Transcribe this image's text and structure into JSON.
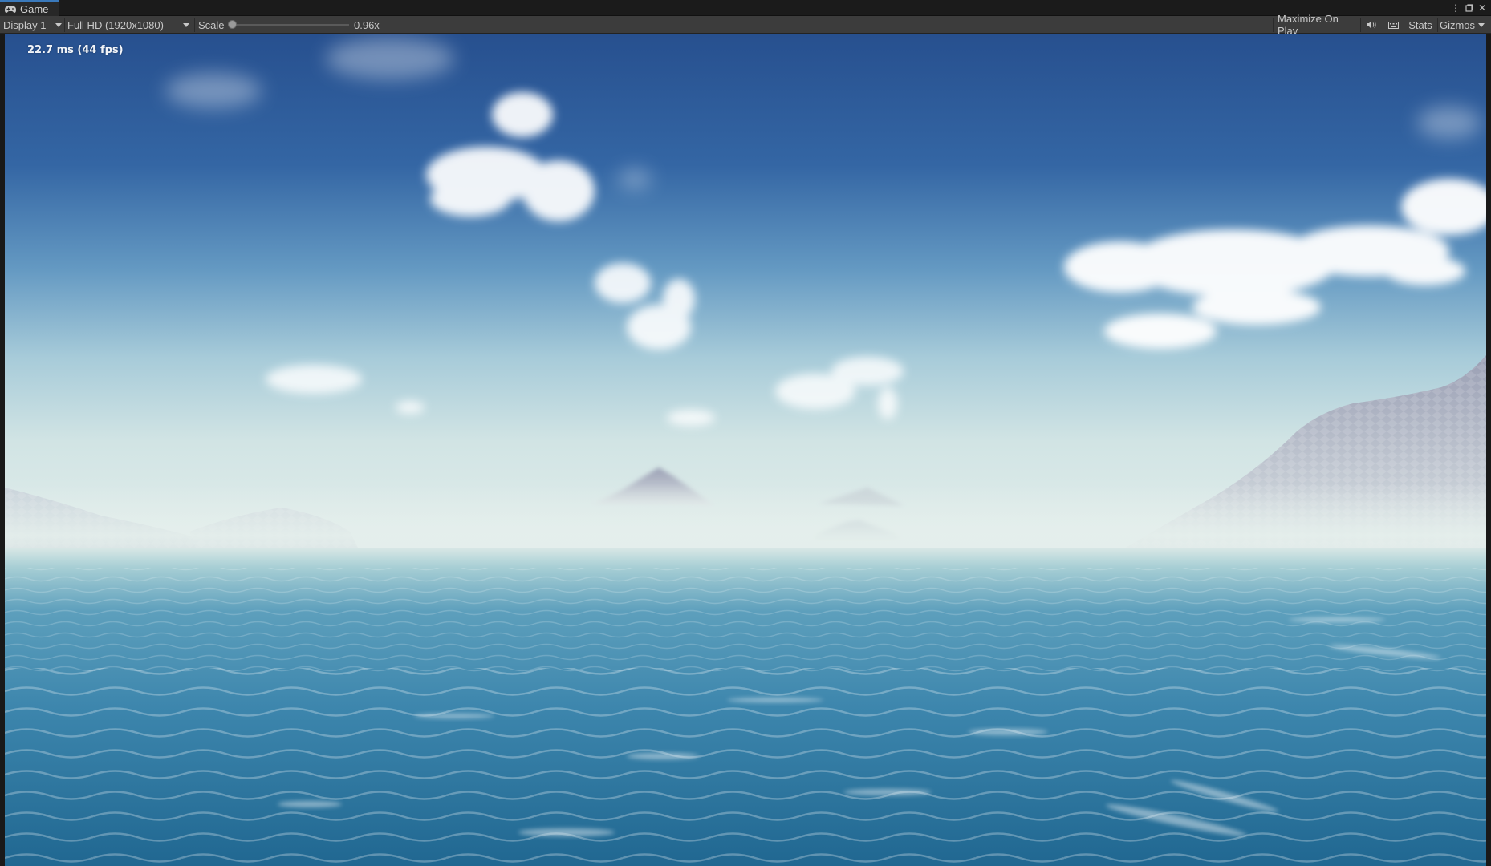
{
  "window": {
    "tab_title": "Game",
    "tab_icon": "gamepad-icon"
  },
  "toolbar": {
    "display": "Display 1",
    "resolution": "Full HD (1920x1080)",
    "scale_label": "Scale",
    "scale_value": "0.96x",
    "scale_fraction": 0.0,
    "maximize_on_play": "Maximize On Play",
    "mute_icon": "speaker-icon",
    "stats_icon": "keyboard-icon",
    "stats": "Stats",
    "gizmos": "Gizmos"
  },
  "viewport": {
    "fps_text": "22.7 ms (44 fps)",
    "scene": "ocean-with-islands-and-clouds"
  },
  "colors": {
    "accent": "#3a79bb",
    "toolbar_bg": "#3c3c3c",
    "sky_top": "#2b5592",
    "horizon": "#dbe9e8",
    "ocean": "#2a6e9a"
  }
}
